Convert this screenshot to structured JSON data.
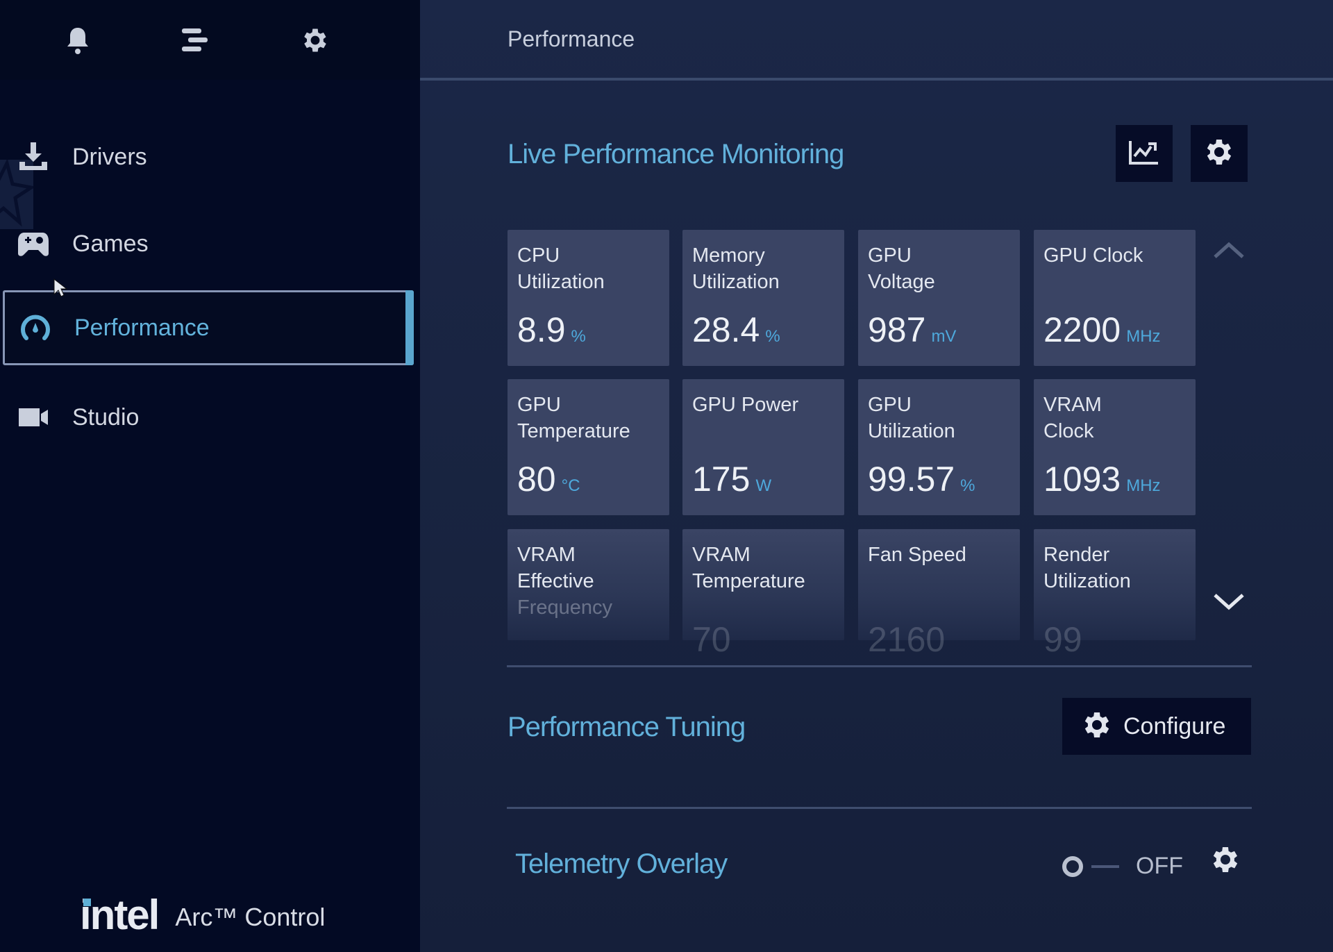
{
  "sidebar": {
    "top_icons": [
      "bell-icon",
      "menu-icon",
      "gear-icon"
    ],
    "items": [
      {
        "label": "Drivers",
        "icon": "download-icon",
        "active": false
      },
      {
        "label": "Games",
        "icon": "gamepad-icon",
        "active": false
      },
      {
        "label": "Performance",
        "icon": "gauge-icon",
        "active": true
      },
      {
        "label": "Studio",
        "icon": "video-camera-icon",
        "active": false
      }
    ],
    "brand": {
      "logo": "intel",
      "product": "Arc™ Control"
    }
  },
  "header": {
    "title": "Performance"
  },
  "monitoring": {
    "title": "Live Performance Monitoring",
    "buttons": [
      "chart-icon",
      "gear-icon"
    ],
    "tiles": [
      {
        "title": [
          "CPU",
          "Utilization"
        ],
        "value": "8.9",
        "unit": "%"
      },
      {
        "title": [
          "Memory",
          "Utilization"
        ],
        "value": "28.4",
        "unit": "%"
      },
      {
        "title": [
          "GPU",
          "Voltage"
        ],
        "value": "987",
        "unit": "mV"
      },
      {
        "title": [
          "GPU Clock",
          ""
        ],
        "value": "2200",
        "unit": "MHz"
      },
      {
        "title": [
          "GPU",
          "Temperature"
        ],
        "value": "80",
        "unit": "°C"
      },
      {
        "title": [
          "GPU Power",
          ""
        ],
        "value": "175",
        "unit": "W"
      },
      {
        "title": [
          "GPU",
          "Utilization"
        ],
        "value": "99.57",
        "unit": "%"
      },
      {
        "title": [
          "VRAM",
          "Clock"
        ],
        "value": "1093",
        "unit": "MHz"
      },
      {
        "title": [
          "VRAM",
          "Effective",
          "Frequency"
        ],
        "value": "",
        "unit": ""
      },
      {
        "title": [
          "VRAM",
          "Temperature"
        ],
        "value": "70",
        "unit": ""
      },
      {
        "title": [
          "Fan Speed",
          ""
        ],
        "value": "2160",
        "unit": ""
      },
      {
        "title": [
          "Render",
          "Utilization"
        ],
        "value": "99",
        "unit": ""
      }
    ]
  },
  "tuning": {
    "title": "Performance Tuning",
    "help": "?",
    "configure_label": "Configure"
  },
  "telemetry": {
    "title": "Telemetry Overlay",
    "toggle_state": "OFF"
  },
  "colors": {
    "accent": "#62b1db",
    "sidebar_bg": "#030a24",
    "main_bg": "#1b2747",
    "tile_bg": "#3a4464"
  }
}
